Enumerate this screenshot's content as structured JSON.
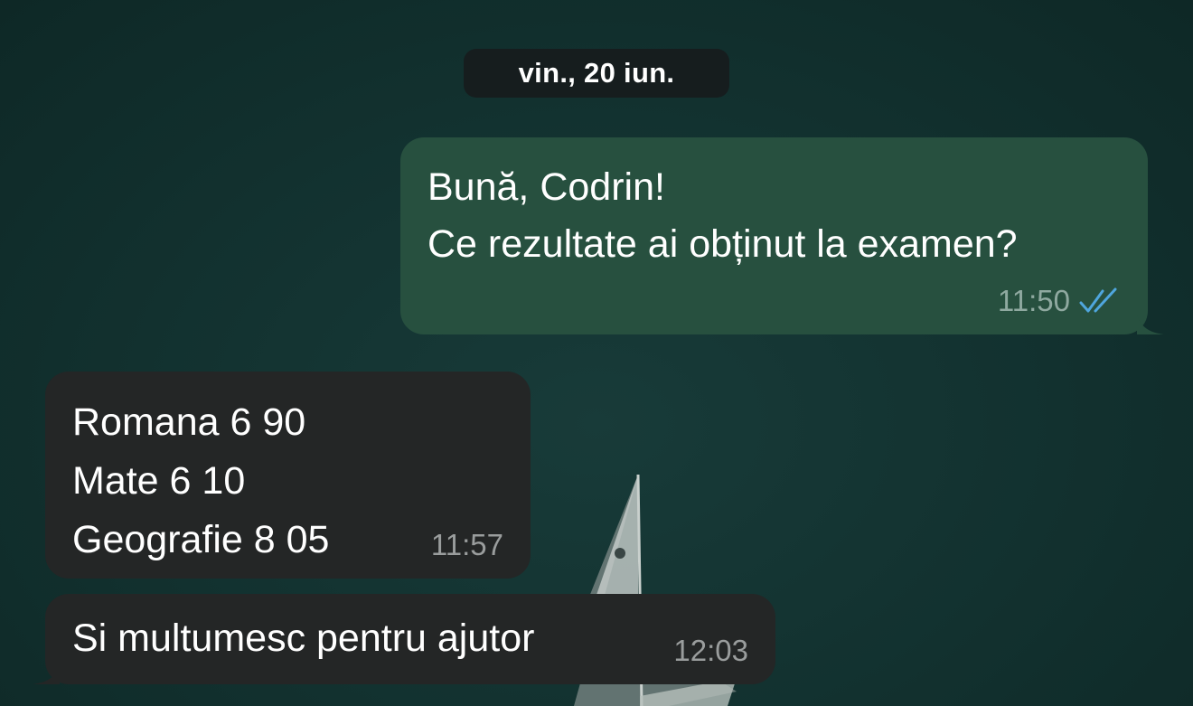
{
  "chat": {
    "date_separator": "vin., 20 iun.",
    "messages": [
      {
        "direction": "outgoing",
        "lines": [
          "Bună, Codrin!",
          "Ce rezultate ai obținut la examen?"
        ],
        "time": "11:50",
        "status_icon": "double-check-read-icon"
      },
      {
        "direction": "incoming",
        "lines": [
          "Romana 6 90",
          "Mate 6 10",
          "Geografie 8 05"
        ],
        "time": "11:57"
      },
      {
        "direction": "incoming",
        "lines": [
          "Si multumesc pentru ajutor"
        ],
        "time": "12:03"
      }
    ]
  },
  "colors": {
    "wallpaper": "#12302f",
    "outgoing_bubble": "#27503f",
    "incoming_bubble": "#242626",
    "read_ticks": "#4fa6de",
    "date_pill": "#161d1e"
  }
}
